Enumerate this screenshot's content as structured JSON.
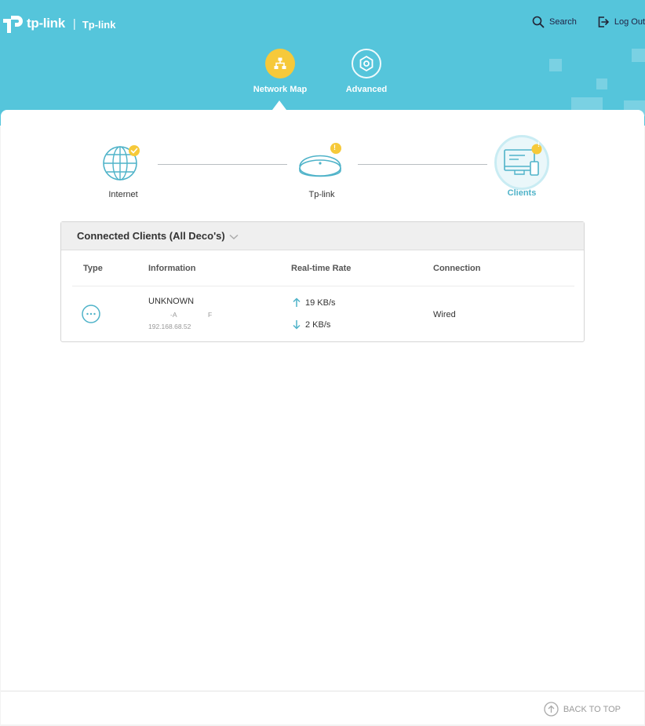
{
  "brand": {
    "logo_text": "tp-link",
    "separator": "|",
    "device_name": "Tp-link"
  },
  "header": {
    "search_label": "Search",
    "logout_label": "Log Out",
    "tabs": [
      {
        "label": "Network Map",
        "icon": "network-map-icon",
        "active": true
      },
      {
        "label": "Advanced",
        "icon": "advanced-gear-icon",
        "active": false
      }
    ]
  },
  "topology": {
    "internet": {
      "label": "Internet",
      "status": "connected"
    },
    "router": {
      "label": "Tp-link",
      "badge": "!"
    },
    "clients": {
      "label": "Clients",
      "badge": "!"
    }
  },
  "clients_table": {
    "title": "Connected Clients (All Deco's)",
    "columns": [
      "Type",
      "Information",
      "Real-time Rate",
      "Connection"
    ],
    "rows": [
      {
        "type_icon": "more-icon",
        "name": "UNKNOWN",
        "mac_part1": "-A",
        "mac_part2": "F",
        "ip": "192.168.68.52",
        "upload": "19 KB/s",
        "download": "2 KB/s",
        "connection": "Wired"
      }
    ]
  },
  "footer": {
    "back_to_top": "BACK TO TOP"
  },
  "colors": {
    "header_bg": "#55c5db",
    "accent_yellow": "#f6c93a",
    "accent_teal": "#4fb3c9"
  }
}
